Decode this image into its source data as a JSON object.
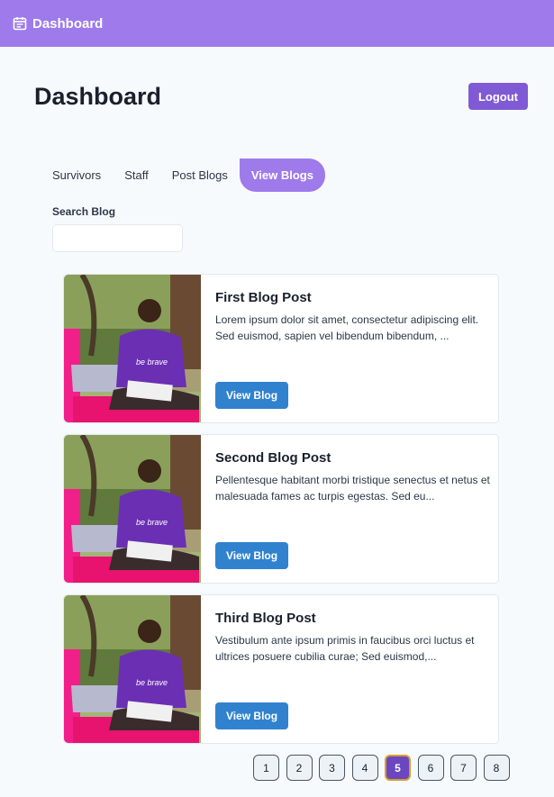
{
  "navbar": {
    "brand": "Dashboard",
    "icon": "calendar-icon"
  },
  "header": {
    "title": "Dashboard",
    "logout_label": "Logout"
  },
  "tabs": [
    {
      "label": "Survivors",
      "active": false
    },
    {
      "label": "Staff",
      "active": false
    },
    {
      "label": "Post Blogs",
      "active": false
    },
    {
      "label": "View Blogs",
      "active": true
    }
  ],
  "search": {
    "label": "Search Blog",
    "value": ""
  },
  "blogs": [
    {
      "title": "First Blog Post",
      "excerpt": "Lorem ipsum dolor sit amet, consectetur adipiscing elit. Sed euismod, sapien vel bibendum bibendum, ...",
      "button": "View Blog",
      "shirt_text": "be brave"
    },
    {
      "title": "Second Blog Post",
      "excerpt": "Pellentesque habitant morbi tristique senectus et netus et malesuada fames ac turpis egestas. Sed eu...",
      "button": "View Blog",
      "shirt_text": "be brave"
    },
    {
      "title": "Third Blog Post",
      "excerpt": "Vestibulum ante ipsum primis in faucibus orci luctus et ultrices posuere cubilia curae; Sed euismod,...",
      "button": "View Blog",
      "shirt_text": "be brave"
    }
  ],
  "pagination": {
    "pages": [
      "1",
      "2",
      "3",
      "4",
      "5",
      "6",
      "7",
      "8"
    ],
    "current": "5"
  },
  "colors": {
    "navbar": "#9f7aea",
    "logout": "#805ad5",
    "view_button": "#3182ce",
    "active_page": "#6b46c1",
    "active_page_border": "#d69e2e"
  }
}
